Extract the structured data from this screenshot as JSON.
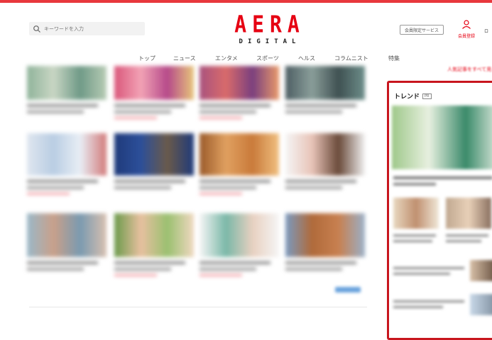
{
  "search": {
    "placeholder": "キーワードを入力"
  },
  "logo": {
    "main": "AERA",
    "sub": "DIGITAL"
  },
  "header": {
    "members_only": "会員限定サービス",
    "register": "会員登録",
    "login": "ロ"
  },
  "nav": [
    "トップ",
    "ニュース",
    "エンタメ",
    "スポーツ",
    "ヘルス",
    "コラムニスト",
    "特集"
  ],
  "see_all": "人気記事をすべて見る",
  "trend": {
    "title": "トレンド",
    "badge": "PR"
  },
  "colors": {
    "brand": "#e60012",
    "frame": "#c8161e"
  }
}
